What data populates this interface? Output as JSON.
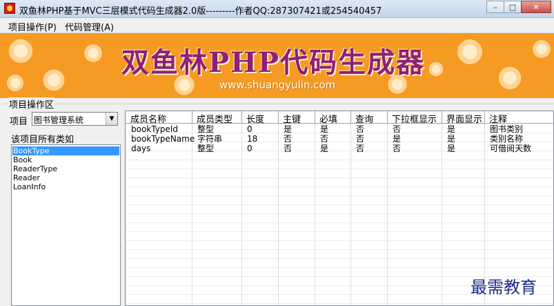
{
  "window": {
    "title": "双鱼林PHP基于MVC三层模式代码生成器2.0版---------作者QQ:287307421或254540457",
    "controls": [
      "–",
      "□",
      "✕"
    ]
  },
  "menu": [
    "项目操作(P)",
    "代码管理(A)"
  ],
  "banner": {
    "title": "双鱼林PHP代码生成器",
    "url": "www.shuangyulin.com"
  },
  "group_label": "项目操作区",
  "project": {
    "label": "项目",
    "selected": "图书管理系统"
  },
  "classes_label": "该项目所有类如",
  "classes": [
    "BookType",
    "Book",
    "ReaderType",
    "Reader",
    "LoanInfo"
  ],
  "selected_class": "BookType",
  "grid": {
    "columns": [
      "成员名称",
      "成员类型",
      "长度",
      "主键",
      "必填",
      "查询",
      "下拉框显示",
      "界面显示",
      "注释"
    ],
    "rows": [
      [
        "bookTypeId",
        "整型",
        "0",
        "是",
        "是",
        "否",
        "否",
        "是",
        "图书类别"
      ],
      [
        "bookTypeName",
        "字符串",
        "18",
        "否",
        "否",
        "否",
        "是",
        "是",
        "类别名称"
      ],
      [
        "days",
        "整型",
        "0",
        "否",
        "是",
        "否",
        "否",
        "是",
        "可借阅天数"
      ]
    ]
  },
  "watermark": "最需教育",
  "colors": {
    "banner_bg": "#f59a22",
    "banner_title": "#8e1f79",
    "selection": "#3399ff",
    "watermark": "#1a2a8c"
  }
}
